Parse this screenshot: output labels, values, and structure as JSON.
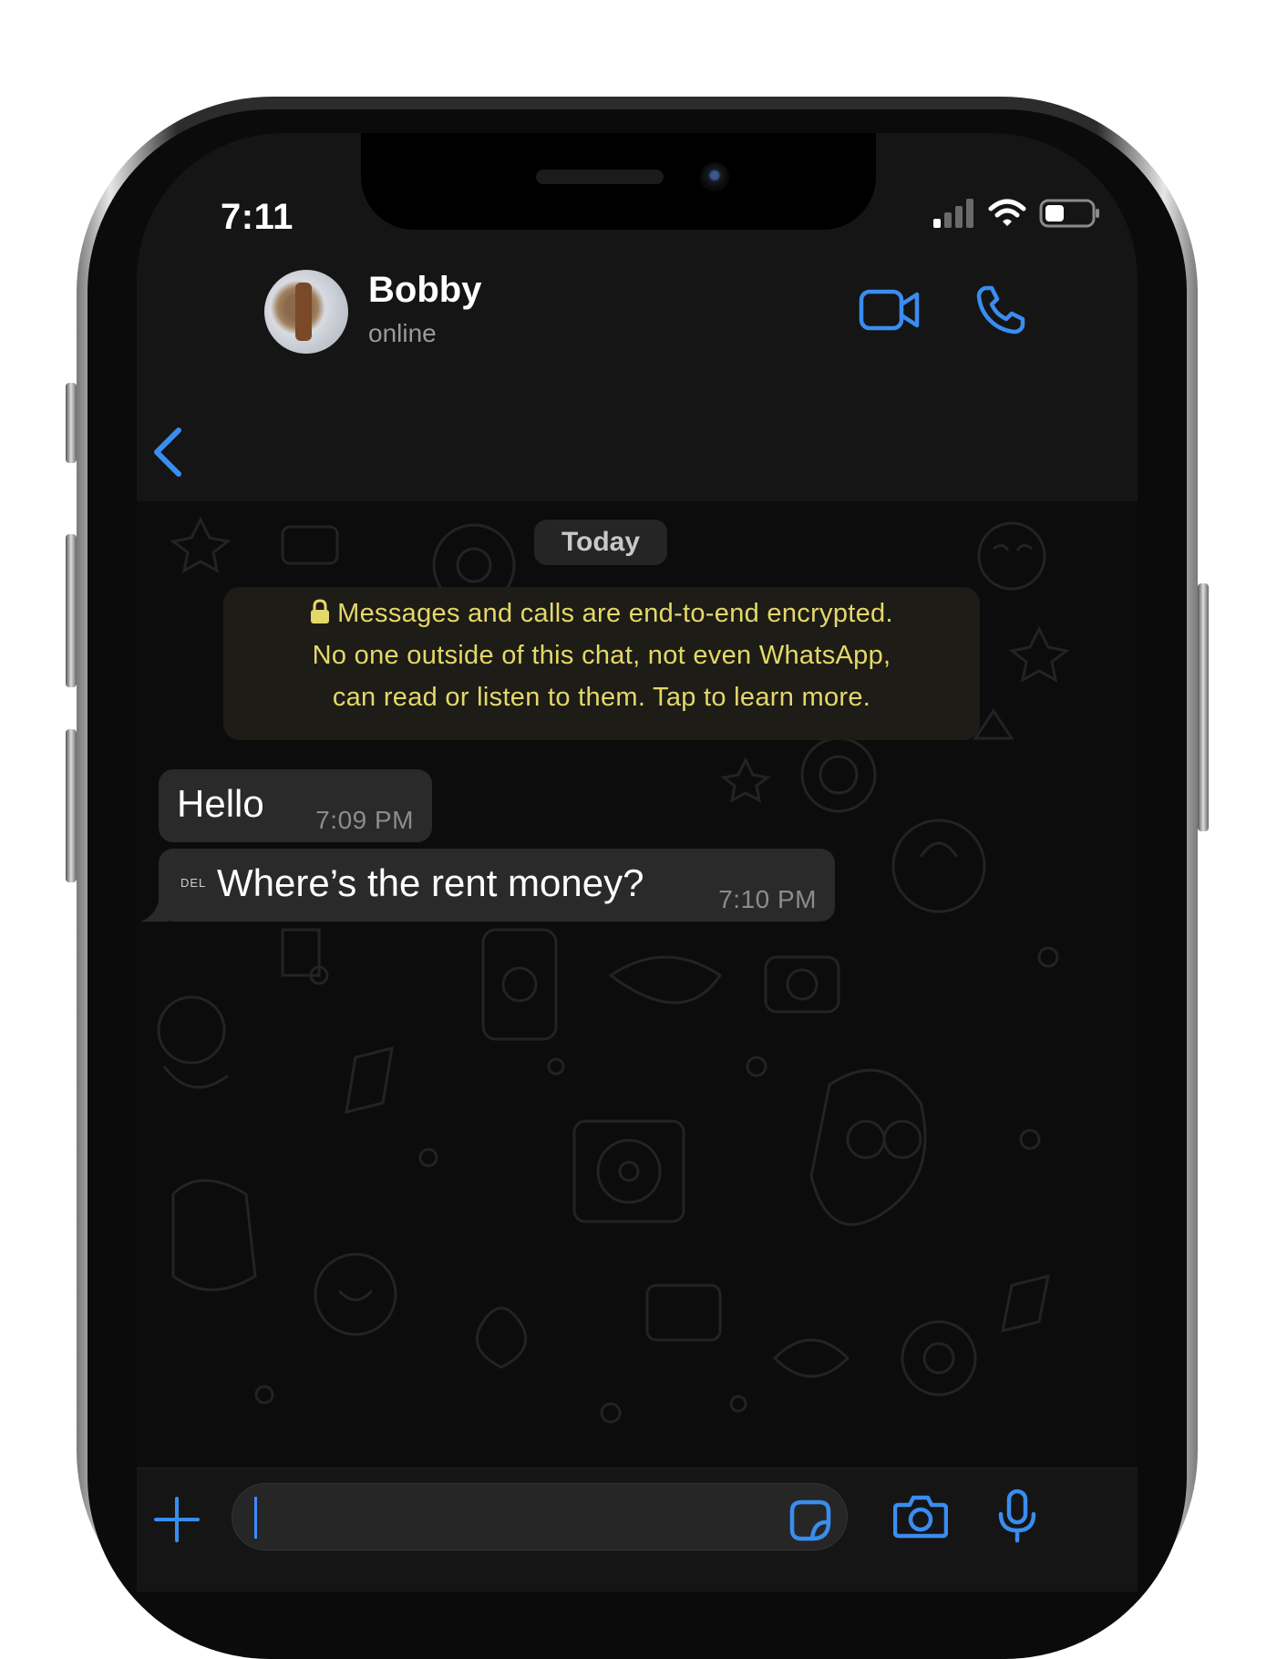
{
  "status_bar": {
    "time": "7:11",
    "signal_icon": "cellular-signal-icon",
    "wifi_icon": "wifi-icon",
    "battery_icon": "battery-icon"
  },
  "header": {
    "back_icon": "chevron-left-icon",
    "contact_name": "Bobby",
    "contact_status": "online",
    "video_icon": "video-camera-icon",
    "call_icon": "phone-icon"
  },
  "chat": {
    "date_label": "Today",
    "encryption_notice": {
      "icon": "lock-icon",
      "line1": "Messages and calls are end-to-end encrypted.",
      "line2": "No one outside of this chat, not even WhatsApp,",
      "line3": "can read or listen to them. Tap to learn more."
    },
    "messages": [
      {
        "text": "Hello",
        "time": "7:09 PM",
        "tag": ""
      },
      {
        "text": "Where’s the rent money?",
        "time": "7:10 PM",
        "tag": "DEL"
      }
    ]
  },
  "input_bar": {
    "attach_icon": "plus-icon",
    "sticker_icon": "sticker-icon",
    "camera_icon": "camera-icon",
    "mic_icon": "microphone-icon",
    "text_value": ""
  },
  "colors": {
    "accent": "#3a8df0",
    "encryption_text": "#e5d86a",
    "bubble": "#2a2a2a",
    "chat_bg": "#0c0c0c",
    "bar_bg": "#151515"
  }
}
